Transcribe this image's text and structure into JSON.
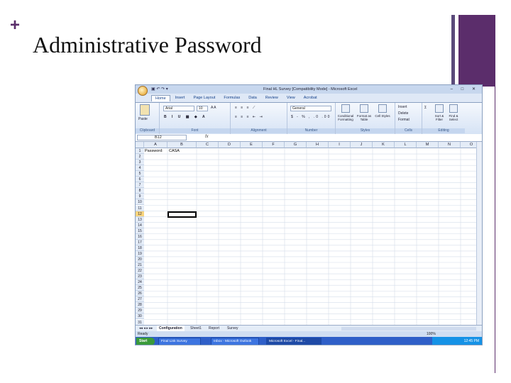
{
  "slide": {
    "plus": "+",
    "title": "Administrative Password"
  },
  "excel": {
    "window_title": "Final HL Survey [Compatibility Mode] - Microsoft Excel",
    "ribbon_tabs": [
      "Home",
      "Insert",
      "Page Layout",
      "Formulas",
      "Data",
      "Review",
      "View",
      "Acrobat"
    ],
    "groups": {
      "clipboard": "Clipboard",
      "paste": "Paste",
      "font": "Font",
      "font_name": "Arial",
      "font_size": "10",
      "alignment": "Alignment",
      "number": "Number",
      "number_format": "General",
      "styles": "Styles",
      "conditional": "Conditional Formatting",
      "format_table": "Format as Table",
      "cell_styles": "Cell Styles",
      "cells": "Cells",
      "insert": "Insert",
      "delete": "Delete",
      "format": "Format",
      "editing": "Editing",
      "sort_filter": "Sort & Filter",
      "find_select": "Find & Select"
    },
    "name_box": "B12",
    "fx": "fx",
    "columns": [
      "A",
      "B",
      "C",
      "D",
      "E",
      "F",
      "G",
      "H",
      "I",
      "J",
      "K",
      "L",
      "M",
      "N",
      "O"
    ],
    "rows": [
      "1",
      "2",
      "3",
      "4",
      "5",
      "6",
      "7",
      "8",
      "9",
      "10",
      "11",
      "12",
      "13",
      "14",
      "15",
      "16",
      "17",
      "18",
      "19",
      "20",
      "21",
      "22",
      "23",
      "24",
      "25",
      "26",
      "27",
      "28",
      "29",
      "30",
      "31"
    ],
    "cells": {
      "a1": "Password:",
      "b1": "CASA"
    },
    "sheet_tabs": [
      "Configuration",
      "Sheet1",
      "Report",
      "Survey"
    ],
    "status": "Ready",
    "zoom": "100%",
    "taskbar": {
      "start": "Start",
      "tasks": [
        "Final Link Survey",
        "Inbox - Microsoft Outlook",
        "Microsoft Excel - Final..."
      ],
      "clock": "12:45 PM"
    }
  }
}
